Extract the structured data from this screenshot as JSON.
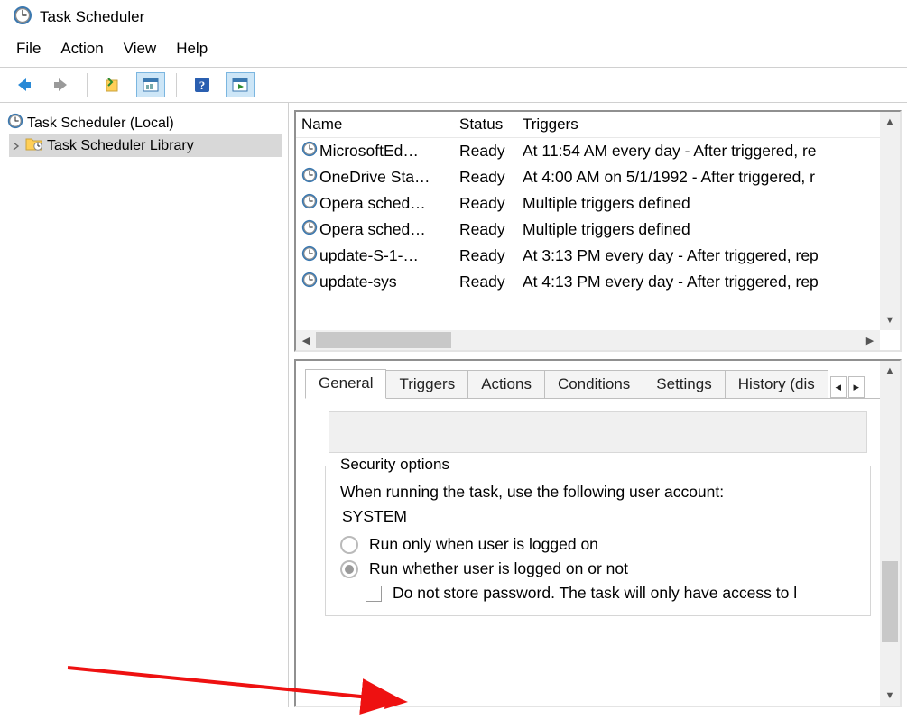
{
  "window": {
    "title": "Task Scheduler"
  },
  "menubar": {
    "file": "File",
    "action": "Action",
    "view": "View",
    "help": "Help"
  },
  "tree": {
    "root": "Task Scheduler (Local)",
    "library": "Task Scheduler Library"
  },
  "task_list": {
    "headers": {
      "name": "Name",
      "status": "Status",
      "triggers": "Triggers"
    },
    "rows": [
      {
        "name": "MicrosoftEd…",
        "status": "Ready",
        "trigger": "At 11:54 AM every day - After triggered, re"
      },
      {
        "name": "OneDrive Sta…",
        "status": "Ready",
        "trigger": "At 4:00 AM on 5/1/1992 - After triggered, r"
      },
      {
        "name": "Opera sched…",
        "status": "Ready",
        "trigger": "Multiple triggers defined"
      },
      {
        "name": "Opera sched…",
        "status": "Ready",
        "trigger": "Multiple triggers defined"
      },
      {
        "name": "update-S-1-…",
        "status": "Ready",
        "trigger": "At 3:13 PM every day - After triggered, rep"
      },
      {
        "name": "update-sys",
        "status": "Ready",
        "trigger": "At 4:13 PM every day - After triggered, rep"
      }
    ]
  },
  "tabs": {
    "general": "General",
    "triggers": "Triggers",
    "actions": "Actions",
    "conditions": "Conditions",
    "settings": "Settings",
    "history": "History (dis"
  },
  "security": {
    "legend": "Security options",
    "prompt": "When running the task, use the following user account:",
    "account": "SYSTEM",
    "radio_logged_on": "Run only when user is logged on",
    "radio_whether": "Run whether user is logged on or not",
    "check_no_pw": "Do not store password.  The task will only have access to l"
  }
}
